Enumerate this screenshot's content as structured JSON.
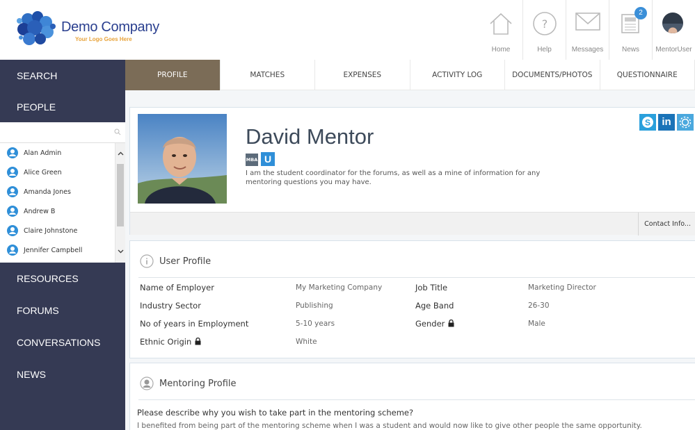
{
  "header": {
    "company_name": "Demo Company",
    "tagline": "Your Logo Goes Here",
    "nav": [
      {
        "label": "Home",
        "icon": "home-icon"
      },
      {
        "label": "Help",
        "icon": "help-icon"
      },
      {
        "label": "Messages",
        "icon": "envelope-icon"
      },
      {
        "label": "News",
        "icon": "newspaper-icon",
        "badge": "2"
      },
      {
        "label": "MentorUser",
        "icon": "user-avatar"
      }
    ]
  },
  "sidebar": {
    "search": "SEARCH",
    "people": "PEOPLE",
    "people_search_placeholder": "",
    "people_list": [
      "Alan Admin",
      "Alice Green",
      "Amanda Jones",
      "Andrew B",
      "Claire Johnstone",
      "Jennifer Campbell"
    ],
    "sections": [
      "RESOURCES",
      "FORUMS",
      "CONVERSATIONS",
      "NEWS"
    ]
  },
  "tabs": [
    "PROFILE",
    "MATCHES",
    "EXPENSES",
    "ACTIVITY LOG",
    "DOCUMENTS/PHOTOS",
    "QUESTIONNAIRE"
  ],
  "active_tab": "PROFILE",
  "profile": {
    "name": "David Mentor",
    "tag_mba": "MBA",
    "tag_u": "U",
    "bio_line1": "I am the student coordinator for the forums, as well as a mine of information for any",
    "bio_line2": "mentoring questions you may have.",
    "contact_button": "Contact Info...",
    "social_skype": "S",
    "social_linkedin": "in"
  },
  "user_profile": {
    "title": "User Profile",
    "left": [
      {
        "label": "Name of Employer",
        "value": "My Marketing Company",
        "locked": false
      },
      {
        "label": "Industry Sector",
        "value": "Publishing",
        "locked": false
      },
      {
        "label": "No of years in Employment",
        "value": "5-10 years",
        "locked": false
      },
      {
        "label": "Ethnic Origin",
        "value": "White",
        "locked": true
      }
    ],
    "right": [
      {
        "label": "Job Title",
        "value": "Marketing Director",
        "locked": false
      },
      {
        "label": "Age Band",
        "value": "26-30",
        "locked": false
      },
      {
        "label": "Gender",
        "value": "Male",
        "locked": true
      }
    ]
  },
  "mentoring_profile": {
    "title": "Mentoring Profile",
    "question": "Please describe why you wish to take part in the mentoring scheme?",
    "answer": "I benefited from being part of the mentoring scheme when I was a student and would now like to give other people the same opportunity."
  },
  "colors": {
    "sidebar_bg": "#353a54",
    "active_tab": "#7b6c57",
    "accent_blue": "#2f8fd8"
  }
}
